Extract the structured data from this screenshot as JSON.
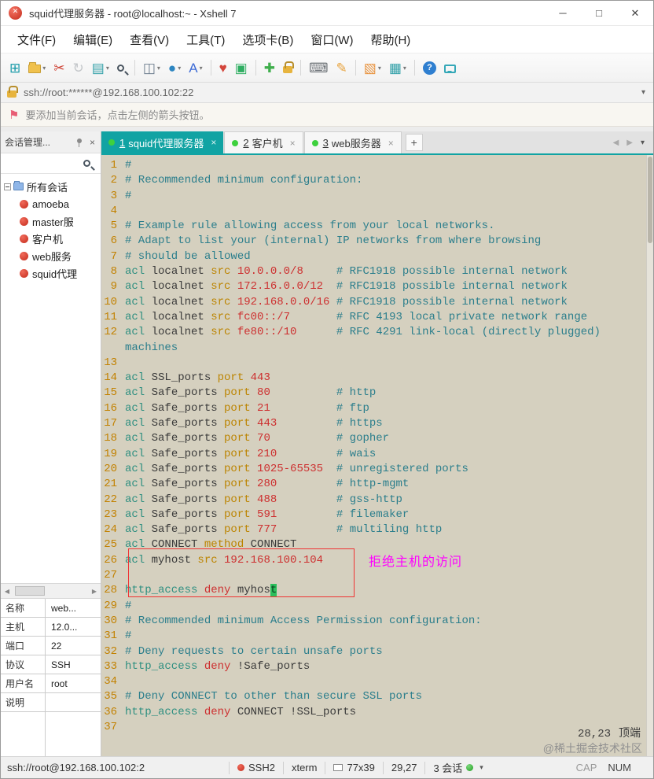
{
  "window": {
    "title": "squid代理服务器 - root@localhost:~ - Xshell 7",
    "controls": {
      "minimize": "─",
      "maximize": "□",
      "close": "✕"
    }
  },
  "menu_bar": {
    "items": [
      "文件(F)",
      "编辑(E)",
      "查看(V)",
      "工具(T)",
      "选项卡(B)",
      "窗口(W)",
      "帮助(H)"
    ]
  },
  "toolbar": {
    "caret_glyph": "▾",
    "items": [
      {
        "name": "new-session-icon",
        "glyph": "⊞",
        "color": "#189aa8"
      },
      {
        "name": "open-session-icon",
        "type": "folder",
        "color": "#f0c14d",
        "dropdown": true
      },
      {
        "name": "disconnect-icon",
        "glyph": "✂",
        "color": "#cf4436"
      },
      {
        "name": "reconnect-icon",
        "glyph": "↻",
        "color": "#9aa0a6",
        "disabled": true
      },
      {
        "name": "session-properties-icon",
        "glyph": "▤",
        "color": "#31a0a8",
        "dropdown": true
      },
      {
        "name": "find-icon",
        "type": "magnifier",
        "color": "#4a5560"
      },
      {
        "divider": true
      },
      {
        "name": "split-screen-icon",
        "glyph": "◫",
        "color": "#6a7b8c",
        "dropdown": true
      },
      {
        "name": "proxy-globe-icon",
        "glyph": "●",
        "color": "#2e86c1",
        "dropdown": true
      },
      {
        "name": "font-icon",
        "glyph": "A",
        "color": "#3d6bd6",
        "dropdown": true
      },
      {
        "divider": true
      },
      {
        "name": "quick-commands-icon",
        "glyph": "♥",
        "color": "#d3453b"
      },
      {
        "name": "compose-bar-icon",
        "glyph": "▣",
        "color": "#2fae62"
      },
      {
        "divider": true
      },
      {
        "name": "fullscreen-icon",
        "glyph": "✚",
        "color": "#3fae4c"
      },
      {
        "name": "lock-screen-icon",
        "type": "lock",
        "color": "#e7b43e"
      },
      {
        "divider": true
      },
      {
        "name": "keyboard-icon",
        "glyph": "⌨",
        "color": "#6f7479"
      },
      {
        "name": "highlight-pen-icon",
        "glyph": "✎",
        "color": "#e8a33d"
      },
      {
        "divider": true
      },
      {
        "name": "file-transfer-icon",
        "glyph": "▧",
        "color": "#e8923d",
        "dropdown": true
      },
      {
        "name": "tile-windows-icon",
        "glyph": "▦",
        "color": "#31a0a8",
        "dropdown": true
      },
      {
        "divider": true
      },
      {
        "name": "help-icon",
        "type": "help",
        "glyph": "?",
        "color": "#2f7fd0"
      },
      {
        "name": "chat-icon",
        "type": "chat",
        "color": "#35a8b8"
      }
    ]
  },
  "address_bar": {
    "value": "ssh://root:******@192.168.100.102:22",
    "dropdown_glyph": "▾"
  },
  "info_bar": {
    "flag_glyph": "⚑",
    "text": "要添加当前会话，点击左侧的箭头按钮。"
  },
  "session_manager": {
    "title": "会话管理...",
    "close_glyph": "×",
    "search_placeholder": "",
    "tree_root": "所有会话",
    "sessions": [
      "amoeba",
      "master服",
      "客户机",
      "web服务",
      "squid代理"
    ],
    "hscroll": {
      "left_glyph": "◀",
      "right_glyph": "▶"
    }
  },
  "properties": {
    "rows": [
      {
        "label": "名称",
        "value": "web..."
      },
      {
        "label": "主机",
        "value": "12.0..."
      },
      {
        "label": "端口",
        "value": "22"
      },
      {
        "label": "协议",
        "value": "SSH"
      },
      {
        "label": "用户名",
        "value": "root"
      },
      {
        "label": "说明",
        "value": ""
      }
    ]
  },
  "tab_bar": {
    "close_glyph": "×",
    "new_tab_glyph": "+",
    "nav_back": "◀",
    "nav_forward": "▶",
    "menu_glyph": "▾",
    "items": [
      {
        "number": "1",
        "title": "squid代理服务器",
        "active": true
      },
      {
        "number": "2",
        "title": "客户机",
        "active": false
      },
      {
        "number": "3",
        "title": "web服务器",
        "active": false
      }
    ]
  },
  "terminal": {
    "colors": {
      "background": "#d5d0bf",
      "line_number": "#c28100",
      "comment": "#2b7e8c",
      "keyword": "#2e8f80",
      "param": "#bc8400",
      "value": "#cd2f2f",
      "text": "#3a3a3a",
      "cursor": "#2bbf5c",
      "annotation": "#ff00ff",
      "box_border": "#f03333"
    },
    "annotation": "拒绝主机的访问",
    "ruler": {
      "position": "28,23",
      "scroll_state": "顶端"
    },
    "watermark": "@稀土掘金技术社区",
    "lines": [
      {
        "n": "1",
        "s": [
          [
            "#",
            "c"
          ]
        ]
      },
      {
        "n": "2",
        "s": [
          [
            "# Recommended minimum configuration:",
            "c"
          ]
        ]
      },
      {
        "n": "3",
        "s": [
          [
            "#",
            "c"
          ]
        ]
      },
      {
        "n": "4",
        "s": []
      },
      {
        "n": "5",
        "s": [
          [
            "# Example rule allowing access from your local networks.",
            "c"
          ]
        ]
      },
      {
        "n": "6",
        "s": [
          [
            "# Adapt to list your (internal) IP networks from where browsing",
            "c"
          ]
        ]
      },
      {
        "n": "7",
        "s": [
          [
            "# should be allowed",
            "c"
          ]
        ]
      },
      {
        "n": "8",
        "s": [
          [
            "acl ",
            "k"
          ],
          [
            "localnet ",
            "i"
          ],
          [
            "src ",
            "p"
          ],
          [
            "10.0.0.0/8",
            "v"
          ],
          [
            "     ",
            "i"
          ],
          [
            "# RFC1918 possible internal network",
            "c"
          ]
        ]
      },
      {
        "n": "9",
        "s": [
          [
            "acl ",
            "k"
          ],
          [
            "localnet ",
            "i"
          ],
          [
            "src ",
            "p"
          ],
          [
            "172.16.0.0/12",
            "v"
          ],
          [
            "  ",
            "i"
          ],
          [
            "# RFC1918 possible internal network",
            "c"
          ]
        ]
      },
      {
        "n": "10",
        "s": [
          [
            "acl ",
            "k"
          ],
          [
            "localnet ",
            "i"
          ],
          [
            "src ",
            "p"
          ],
          [
            "192.168.0.0/16",
            "v"
          ],
          [
            " ",
            "i"
          ],
          [
            "# RFC1918 possible internal network",
            "c"
          ]
        ]
      },
      {
        "n": "11",
        "s": [
          [
            "acl ",
            "k"
          ],
          [
            "localnet ",
            "i"
          ],
          [
            "src ",
            "p"
          ],
          [
            "fc00::/7",
            "v"
          ],
          [
            "       ",
            "i"
          ],
          [
            "# RFC 4193 local private network range",
            "c"
          ]
        ]
      },
      {
        "n": "12",
        "s": [
          [
            "acl ",
            "k"
          ],
          [
            "localnet ",
            "i"
          ],
          [
            "src ",
            "p"
          ],
          [
            "fe80::/10",
            "v"
          ],
          [
            "      ",
            "i"
          ],
          [
            "# RFC 4291 link-local (directly plugged)",
            "c"
          ]
        ]
      },
      {
        "n": "",
        "s": [
          [
            "machines",
            "c"
          ]
        ]
      },
      {
        "n": "13",
        "s": []
      },
      {
        "n": "14",
        "s": [
          [
            "acl ",
            "k"
          ],
          [
            "SSL_ports ",
            "i"
          ],
          [
            "port ",
            "p"
          ],
          [
            "443",
            "v"
          ]
        ]
      },
      {
        "n": "15",
        "s": [
          [
            "acl ",
            "k"
          ],
          [
            "Safe_ports ",
            "i"
          ],
          [
            "port ",
            "p"
          ],
          [
            "80",
            "v"
          ],
          [
            "          ",
            "i"
          ],
          [
            "# http",
            "c"
          ]
        ]
      },
      {
        "n": "16",
        "s": [
          [
            "acl ",
            "k"
          ],
          [
            "Safe_ports ",
            "i"
          ],
          [
            "port ",
            "p"
          ],
          [
            "21",
            "v"
          ],
          [
            "          ",
            "i"
          ],
          [
            "# ftp",
            "c"
          ]
        ]
      },
      {
        "n": "17",
        "s": [
          [
            "acl ",
            "k"
          ],
          [
            "Safe_ports ",
            "i"
          ],
          [
            "port ",
            "p"
          ],
          [
            "443",
            "v"
          ],
          [
            "         ",
            "i"
          ],
          [
            "# https",
            "c"
          ]
        ]
      },
      {
        "n": "18",
        "s": [
          [
            "acl ",
            "k"
          ],
          [
            "Safe_ports ",
            "i"
          ],
          [
            "port ",
            "p"
          ],
          [
            "70",
            "v"
          ],
          [
            "          ",
            "i"
          ],
          [
            "# gopher",
            "c"
          ]
        ]
      },
      {
        "n": "19",
        "s": [
          [
            "acl ",
            "k"
          ],
          [
            "Safe_ports ",
            "i"
          ],
          [
            "port ",
            "p"
          ],
          [
            "210",
            "v"
          ],
          [
            "         ",
            "i"
          ],
          [
            "# wais",
            "c"
          ]
        ]
      },
      {
        "n": "20",
        "s": [
          [
            "acl ",
            "k"
          ],
          [
            "Safe_ports ",
            "i"
          ],
          [
            "port ",
            "p"
          ],
          [
            "1025-65535",
            "v"
          ],
          [
            "  ",
            "i"
          ],
          [
            "# unregistered ports",
            "c"
          ]
        ]
      },
      {
        "n": "21",
        "s": [
          [
            "acl ",
            "k"
          ],
          [
            "Safe_ports ",
            "i"
          ],
          [
            "port ",
            "p"
          ],
          [
            "280",
            "v"
          ],
          [
            "         ",
            "i"
          ],
          [
            "# http-mgmt",
            "c"
          ]
        ]
      },
      {
        "n": "22",
        "s": [
          [
            "acl ",
            "k"
          ],
          [
            "Safe_ports ",
            "i"
          ],
          [
            "port ",
            "p"
          ],
          [
            "488",
            "v"
          ],
          [
            "         ",
            "i"
          ],
          [
            "# gss-http",
            "c"
          ]
        ]
      },
      {
        "n": "23",
        "s": [
          [
            "acl ",
            "k"
          ],
          [
            "Safe_ports ",
            "i"
          ],
          [
            "port ",
            "p"
          ],
          [
            "591",
            "v"
          ],
          [
            "         ",
            "i"
          ],
          [
            "# filemaker",
            "c"
          ]
        ]
      },
      {
        "n": "24",
        "s": [
          [
            "acl ",
            "k"
          ],
          [
            "Safe_ports ",
            "i"
          ],
          [
            "port ",
            "p"
          ],
          [
            "777",
            "v"
          ],
          [
            "         ",
            "i"
          ],
          [
            "# multiling http",
            "c"
          ]
        ]
      },
      {
        "n": "25",
        "s": [
          [
            "acl ",
            "k"
          ],
          [
            "CONNECT ",
            "i"
          ],
          [
            "method ",
            "p"
          ],
          [
            "CONNECT",
            "i"
          ]
        ]
      },
      {
        "n": "26",
        "s": [
          [
            "acl ",
            "k"
          ],
          [
            "myhost ",
            "i"
          ],
          [
            "src ",
            "p"
          ],
          [
            "192.168.100.104",
            "v"
          ]
        ]
      },
      {
        "n": "27",
        "s": []
      },
      {
        "n": "28",
        "s": [
          [
            "http_access ",
            "k"
          ],
          [
            "deny ",
            "v"
          ],
          [
            "myhos",
            "i"
          ],
          [
            "t",
            "cur"
          ]
        ]
      },
      {
        "n": "29",
        "s": [
          [
            "#",
            "c"
          ]
        ]
      },
      {
        "n": "30",
        "s": [
          [
            "# Recommended minimum Access Permission configuration:",
            "c"
          ]
        ]
      },
      {
        "n": "31",
        "s": [
          [
            "#",
            "c"
          ]
        ]
      },
      {
        "n": "32",
        "s": [
          [
            "# Deny requests to certain unsafe ports",
            "c"
          ]
        ]
      },
      {
        "n": "33",
        "s": [
          [
            "http_access ",
            "k"
          ],
          [
            "deny ",
            "v"
          ],
          [
            "!Safe_ports",
            "i"
          ]
        ]
      },
      {
        "n": "34",
        "s": []
      },
      {
        "n": "35",
        "s": [
          [
            "# Deny CONNECT to other than secure SSL ports",
            "c"
          ]
        ]
      },
      {
        "n": "36",
        "s": [
          [
            "http_access ",
            "k"
          ],
          [
            "deny ",
            "v"
          ],
          [
            "CONNECT !SSL_ports",
            "i"
          ]
        ]
      },
      {
        "n": "37",
        "s": []
      }
    ]
  },
  "status_bar": {
    "url": "ssh://root@192.168.100.102:2",
    "protocol": "SSH2",
    "terminal_type": "xterm",
    "size": "77x39",
    "cursor_position": "29,27",
    "session_count": "3 会话",
    "menu_glyph": "▾",
    "cap": "CAP",
    "num": "NUM"
  }
}
